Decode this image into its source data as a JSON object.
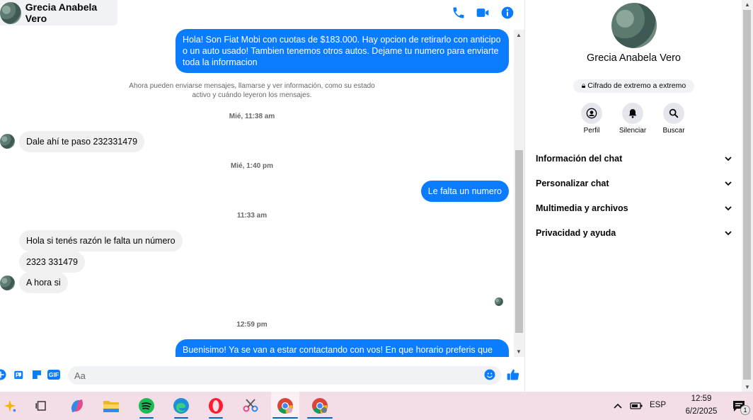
{
  "header": {
    "contact_name": "Grecia Anabela Vero",
    "icons": [
      "phone-icon",
      "video-icon",
      "info-icon"
    ]
  },
  "messages": {
    "msg1": "Hola! Son Fiat Mobi con cuotas de $183.000. Hay opcion de retirarlo con anticipo o un auto usado! Tambien tenemos otros autos. Dejame tu numero para enviarte toda la informacion",
    "info_line1": "Ahora pueden enviarse mensajes, llamarse y ver información, como su estado",
    "info_line2": "activo y cuándo leyeron los mensajes.",
    "ts1": "Mié, 11:38 am",
    "msg2": "Dale ahí te paso 232331479",
    "ts2": "Mié, 1:40 pm",
    "msg3": "Le falta un numero",
    "ts3": "11:33 am",
    "msg4": "Hola si tenés razón le falta un número",
    "msg5": "2323 331479",
    "msg6": "A hora si",
    "ts4": "12:59 pm",
    "msg7": "Buenisimo! Ya se van a estar contactando con vos! En que horario preferis que se"
  },
  "composer": {
    "placeholder": "Aa",
    "gif_label": "GIF"
  },
  "info_pane": {
    "name": "Grecia Anabela Vero",
    "e2e": "Cifrado de extremo a extremo",
    "actions": [
      "Perfil",
      "Silenciar",
      "Buscar"
    ],
    "sections": [
      "Información del chat",
      "Personalizar chat",
      "Multimedia y archivos",
      "Privacidad y ayuda"
    ]
  },
  "taskbar": {
    "language": "ESP",
    "time": "12:59",
    "date": "6/2/2025",
    "notification_count": "1"
  },
  "colors": {
    "accent": "#0a7cff",
    "taskbar": "#f3dde6"
  }
}
